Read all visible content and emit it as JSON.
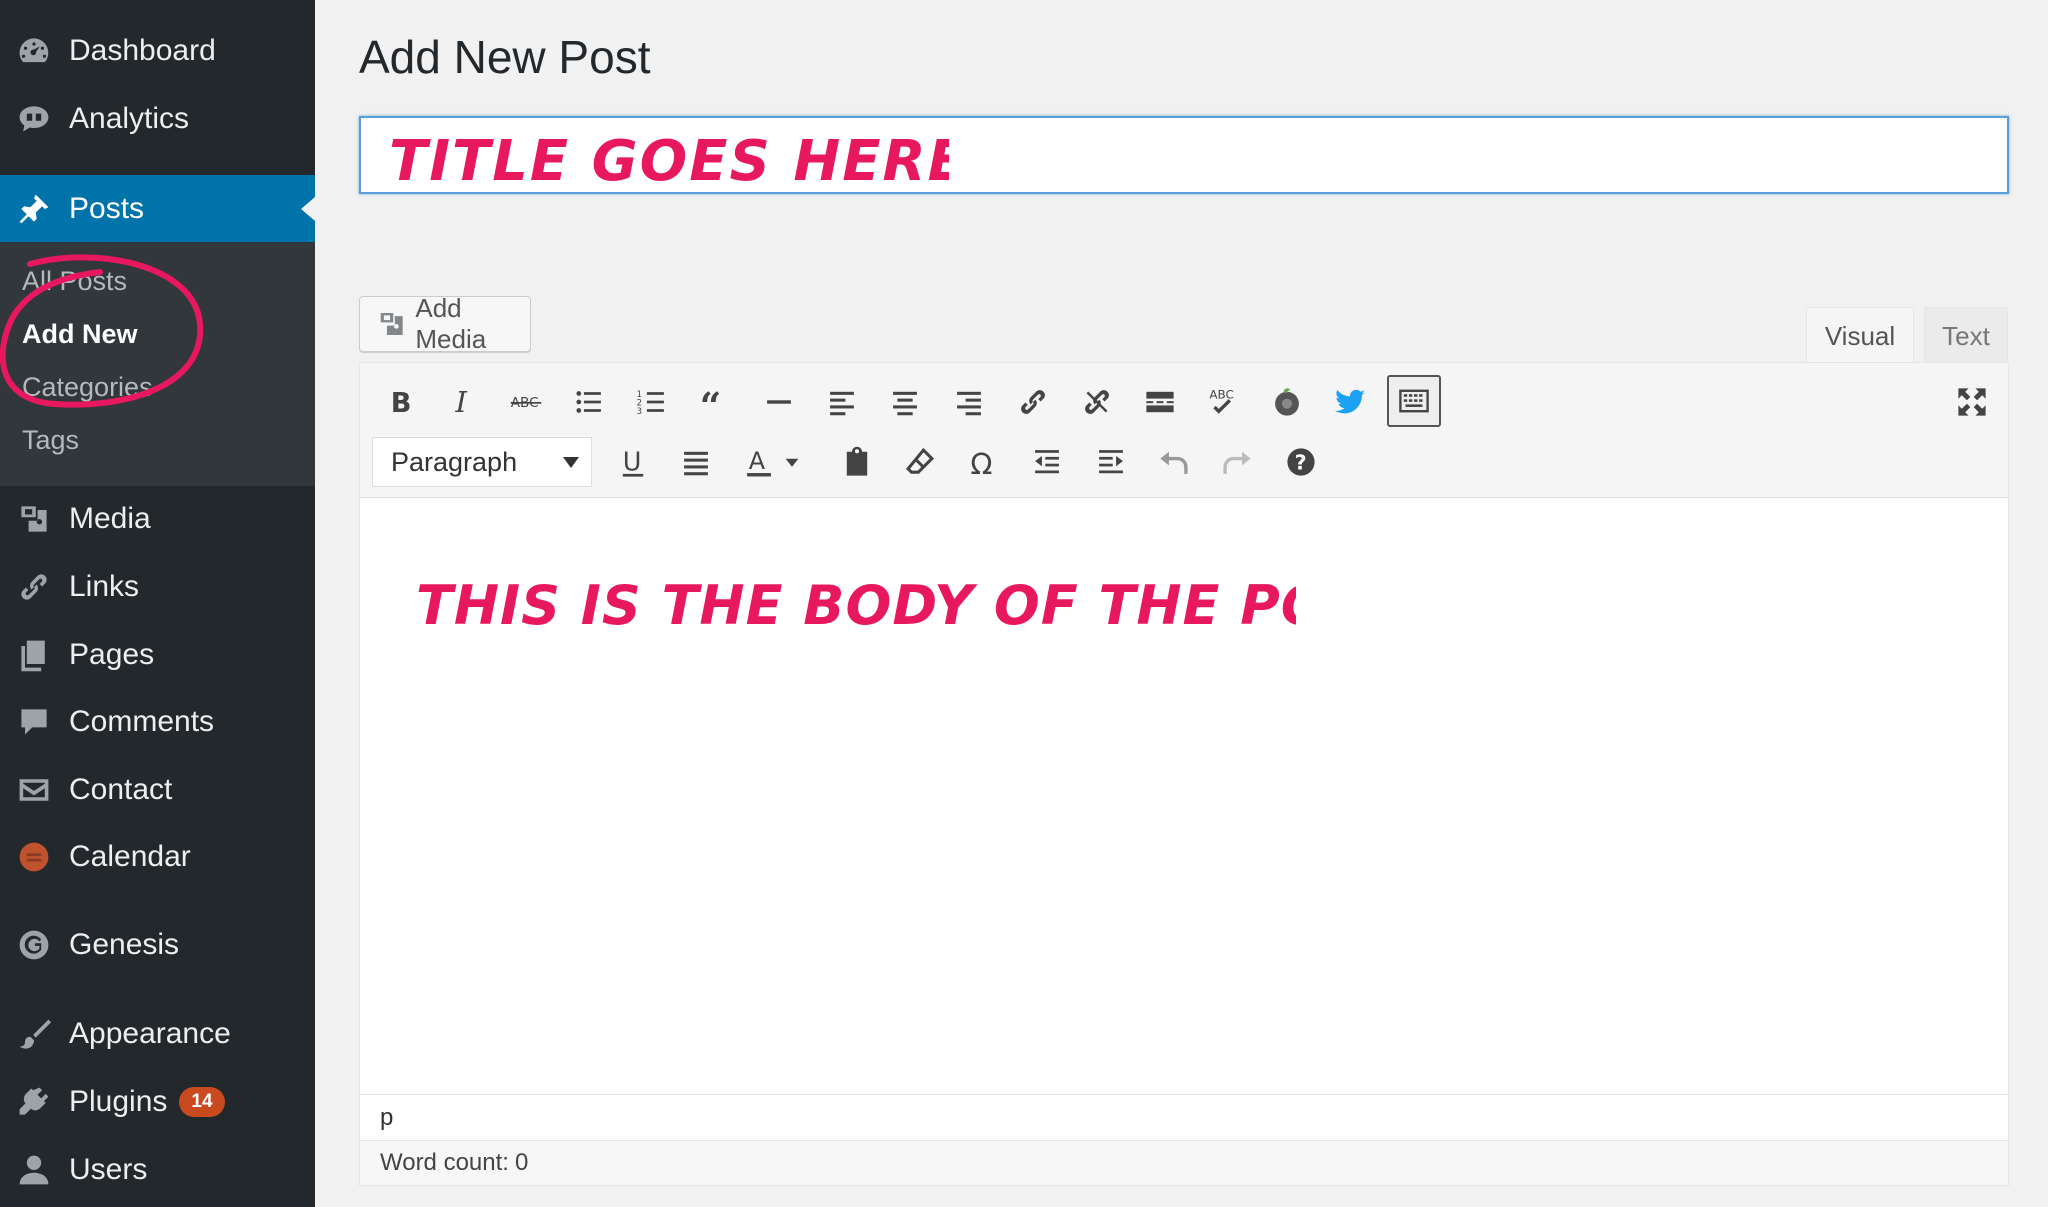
{
  "sidebar": {
    "items": [
      {
        "label": "Dashboard",
        "icon": "dashboard-icon"
      },
      {
        "label": "Analytics",
        "icon": "analytics-icon"
      },
      {
        "label": "Posts",
        "icon": "pushpin-icon",
        "active": true
      },
      {
        "label": "Media",
        "icon": "media-icon"
      },
      {
        "label": "Links",
        "icon": "link-icon"
      },
      {
        "label": "Pages",
        "icon": "pages-icon"
      },
      {
        "label": "Comments",
        "icon": "comment-icon"
      },
      {
        "label": "Contact",
        "icon": "mail-icon"
      },
      {
        "label": "Calendar",
        "icon": "calendar-icon"
      },
      {
        "label": "Genesis",
        "icon": "genesis-icon"
      },
      {
        "label": "Appearance",
        "icon": "brush-icon"
      },
      {
        "label": "Plugins",
        "icon": "plugin-icon",
        "badge": "14"
      },
      {
        "label": "Users",
        "icon": "user-icon"
      }
    ],
    "submenu": [
      {
        "label": "All Posts"
      },
      {
        "label": "Add New",
        "current": true
      },
      {
        "label": "Categories"
      },
      {
        "label": "Tags"
      }
    ]
  },
  "main": {
    "page_title": "Add New Post",
    "title_annotation": "TITLE GOES HERE",
    "add_media_label": "Add Media",
    "tabs": {
      "visual": "Visual",
      "text": "Text"
    },
    "format_select": {
      "value": "Paragraph"
    },
    "toolbar_icons_row1": [
      "bold-icon",
      "italic-icon",
      "strikethrough-icon",
      "bullet-list-icon",
      "numbered-list-icon",
      "blockquote-icon",
      "horizontal-rule-icon",
      "align-left-icon",
      "align-center-icon",
      "align-right-icon",
      "insert-link-icon",
      "unlink-icon",
      "read-more-icon",
      "spellcheck-icon",
      "evernote-icon",
      "twitter-icon",
      "toolbar-toggle-icon"
    ],
    "toolbar_icons_row2": [
      "underline-icon",
      "justify-icon",
      "text-color-icon",
      "paste-text-icon",
      "clear-formatting-icon",
      "special-character-icon",
      "outdent-icon",
      "indent-icon",
      "undo-icon",
      "redo-icon",
      "help-icon",
      "fullscreen-icon"
    ],
    "body_annotation": "THIS IS THE BODY OF THE POST",
    "status_path": "p",
    "word_count_label": "Word count:",
    "word_count_value": "0"
  },
  "colors": {
    "sidebar_bg": "#23282d",
    "submenu_bg": "#32373c",
    "active_blue": "#0073aa",
    "annotation_pink": "#e8185f",
    "twitter_blue": "#1da1f2",
    "badge_orange": "#ca4a1f"
  }
}
